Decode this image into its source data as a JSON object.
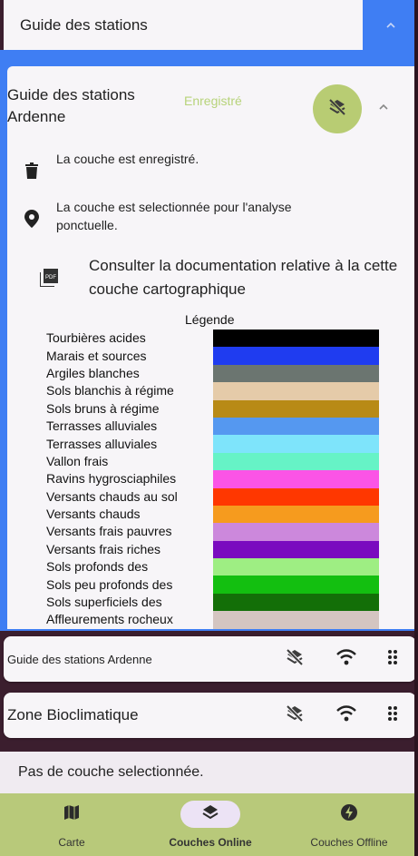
{
  "top_section": {
    "title": "Guide des stations"
  },
  "panel": {
    "title": "Guide des stations Ardenne",
    "saved_label": "Enregistré",
    "info": [
      {
        "icon": "trash-icon",
        "text": "La couche est enregistré."
      },
      {
        "icon": "location-pin-icon",
        "text": "La couche est selectionnée pour l'analyse ponctuelle."
      }
    ],
    "doc_link": "Consulter la documentation relative à la cette couche cartographique"
  },
  "legend": {
    "title": "Légende",
    "items": [
      {
        "label": "Tourbières acides",
        "color": "#000000"
      },
      {
        "label": "Marais et sources",
        "color": "#1f3cf0"
      },
      {
        "label": "Argiles blanches",
        "color": "#6b7570"
      },
      {
        "label": "Sols blanchis à régime",
        "color": "#e5cba9"
      },
      {
        "label": "Sols bruns à régime",
        "color": "#b88a16"
      },
      {
        "label": "Terrasses alluviales",
        "color": "#5598f0"
      },
      {
        "label": "Terrasses alluviales",
        "color": "#7ee4fb"
      },
      {
        "label": "Vallon frais",
        "color": "#66f3c6"
      },
      {
        "label": "Ravins hygrosciaphiles",
        "color": "#fb54e6"
      },
      {
        "label": "Versants chauds au sol",
        "color": "#ff3700"
      },
      {
        "label": "Versants chauds",
        "color": "#f69b1e"
      },
      {
        "label": "Versants frais pauvres",
        "color": "#cc88dc"
      },
      {
        "label": "Versants frais riches",
        "color": "#7a0bbf"
      },
      {
        "label": "Sols profonds des",
        "color": "#9eee83"
      },
      {
        "label": "Sols peu profonds des",
        "color": "#13bf10"
      },
      {
        "label": "Sols superficiels des",
        "color": "#136f08"
      },
      {
        "label": "Affleurements rocheux",
        "color": "#d4c5c1"
      }
    ]
  },
  "layers": [
    {
      "name": "Guide des stations Ardenne"
    },
    {
      "name": "Zone Bioclimatique"
    }
  ],
  "status": {
    "text": "Pas de couche selectionnée."
  },
  "nav": {
    "items": [
      {
        "label": "Carte",
        "icon": "map-icon",
        "active": false
      },
      {
        "label": "Couches Online",
        "icon": "layers-icon",
        "active": true
      },
      {
        "label": "Couches Offline",
        "icon": "flash-icon",
        "active": false
      }
    ]
  },
  "colors": {
    "accent_blue": "#3f7ef3",
    "accent_green": "#b8cc73",
    "nav_bg": "#b8c97a",
    "saved_text": "#b7d37a"
  }
}
